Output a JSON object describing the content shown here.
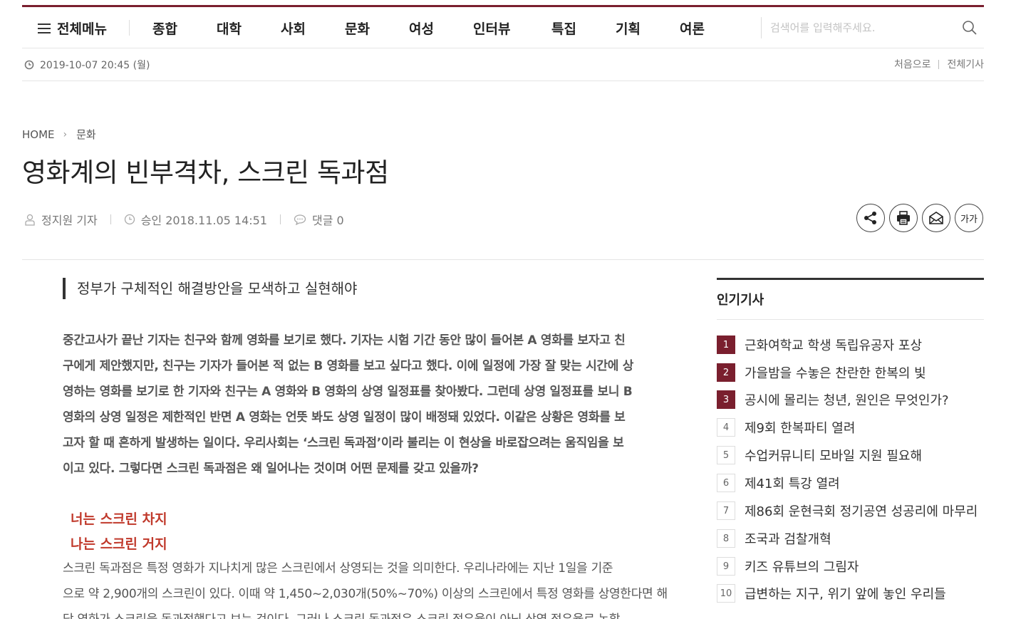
{
  "nav": {
    "menu_all": "전체메뉴",
    "items": [
      "종합",
      "대학",
      "사회",
      "문화",
      "여성",
      "인터뷰",
      "특집",
      "기획",
      "여론"
    ],
    "search_placeholder": "검색어를 입력해주세요."
  },
  "datebar": {
    "date": "2019-10-07 20:45 (월)",
    "links": [
      "처음으로",
      "전체기사"
    ]
  },
  "breadcrumb": {
    "home": "HOME",
    "section": "문화"
  },
  "article": {
    "title": "영화계의 빈부격차, 스크린 독과점",
    "author": "정지원 기자",
    "approved": "승인 2018.11.05 14:51",
    "comments": "댓글 0",
    "font_size_label": "가가",
    "subtitle": "정부가 구체적인 해결방안을 모색하고 실현해야",
    "lead_lines": [
      " 중간고사가 끝난 기자는 친구와 함께 영화를 보기로 했다. 기자는 시험 기간 동안 많이 들어본 A 영화를 보자고 친",
      "구에게 제안했지만, 친구는 기자가 들어본 적 없는 B 영화를 보고 싶다고 했다. 이에 일정에 가장 잘 맞는 시간에 상",
      "영하는 영화를 보기로 한 기자와 친구는 A 영화와 B 영화의 상영 일정표를 찾아봤다. 그런데 상영 일정표를 보니 B",
      "영화의 상영 일정은 제한적인 반면 A 영화는 언뜻 봐도 상영 일정이 많이 배정돼 있었다. 이같은 상황은 영화를 보",
      "고자 할 때 흔하게 발생하는 일이다. 우리사회는 ‘스크린 독과점’이라 불리는 이 현상을 바로잡으려는 움직임을 보",
      "이고 있다. 그렇다면 스크린 독과점은 왜 일어나는 것이며 어떤 문제를 갖고 있을까?"
    ],
    "heading_1": "너는 스크린 차지",
    "heading_2": "나는 스크린 거지",
    "p2_lines": [
      " 스크린 독과점은 특정 영화가 지나치게 많은 스크린에서 상영되는 것을 의미한다. 우리나라에는 지난 1일을 기준",
      "으로 약 2,900개의 스크린이 있다. 이때 약 1,450~2,030개(50%~70%) 이상의 스크린에서 특정 영화를 상영한다면 해",
      "당 영화가 스크린을 독과점했다고 보는 것이다. 그러나 스크린 독과점은 스크린 점유율이 아닌 상영 점유율로 논할"
    ]
  },
  "sidebar": {
    "title": "인기기사",
    "items": [
      {
        "num": "1",
        "text": "근화여학교 학생 독립유공자 포상"
      },
      {
        "num": "2",
        "text": "가을밤을 수놓은 찬란한 한복의 빛"
      },
      {
        "num": "3",
        "text": "공시에 몰리는 청년, 원인은 무엇인가?"
      },
      {
        "num": "4",
        "text": "제9회 한복파티 열려"
      },
      {
        "num": "5",
        "text": "수업커뮤니티 모바일 지원 필요해"
      },
      {
        "num": "6",
        "text": "제41회 특강 열려"
      },
      {
        "num": "7",
        "text": "제86회 운현극회 정기공연 성공리에 마무리"
      },
      {
        "num": "8",
        "text": "조국과 검찰개혁"
      },
      {
        "num": "9",
        "text": "키즈 유튜브의 그림자"
      },
      {
        "num": "10",
        "text": "급변하는 지구, 위기 앞에 놓인 우리들"
      }
    ]
  },
  "colors": {
    "brand": "#7a1f2e",
    "heading_red": "#c0392b"
  },
  "icons": [
    "hamburger-icon",
    "search-icon",
    "clock-icon",
    "person-icon",
    "comment-icon",
    "share-icon",
    "print-icon",
    "email-icon"
  ]
}
